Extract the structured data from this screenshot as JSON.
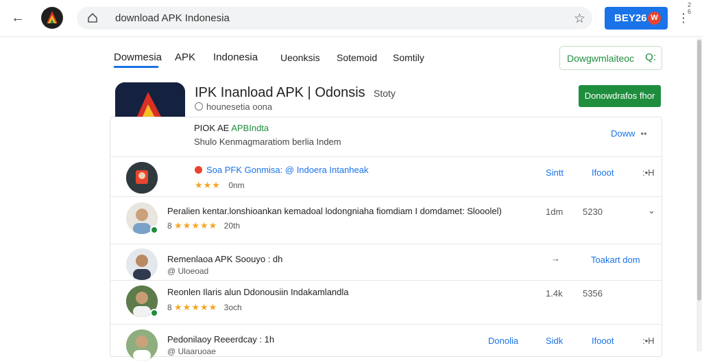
{
  "browser": {
    "address": "download APK Indonesia",
    "profile_label": "BEY26",
    "profile_badge": "W",
    "corner_digits": "2\n6"
  },
  "nav": {
    "tabs": [
      "Dowmesia",
      "APK",
      "Indonesia",
      "Ueonksis",
      "Sotemoid",
      "Somtily"
    ],
    "search_label": "Dowgwmlaiteoc",
    "search_icon_label": "Q:"
  },
  "app": {
    "title": "IPK Inanload APK | Odonsis",
    "side_label": "Stoty",
    "subtitle": "hounesetia oona",
    "install_label": "Donowdrafos fhor"
  },
  "card": {
    "head_prefix": "PIOK AE",
    "head_green": "APBIndta",
    "head_sub": "Shulo Kenmagmaratiom berlia Indem",
    "more_label": "Doww",
    "more_dots": "••"
  },
  "rows": [
    {
      "title": "Soa PFK Gonmisa: @ Indoera Intanheak",
      "rating": "2.5",
      "stars": "★★★",
      "meta": "0nm",
      "action1": "Sintt",
      "action2": "Ifooot",
      "action3": ":•H"
    },
    {
      "title": "Peralien kentar.lonshioankan kemadoal lodongniaha fiomdiam I domdamet: Slooolel)",
      "rating": "8",
      "stars": "★★★★★",
      "meta": "20th",
      "action1": "1dm",
      "action2": "5230",
      "action3": "⌄"
    },
    {
      "title": "Remenlaoa APK Soouyo : dh",
      "meta": "@ Uloeoad",
      "action1": "→",
      "action2": "Toakart dom"
    },
    {
      "title": "Reonlen Ilaris alun Ddonousiin  Indakamlandla",
      "rating": "8",
      "stars": "★★★★★",
      "meta": "3och",
      "action1": "1.4k",
      "action2": "5356"
    },
    {
      "title": "Pedonilaoy Reeerdcay : 1h",
      "meta": "@ Ulaaruoae",
      "action0": "Donolia",
      "action1": "Sidk",
      "action2": "Ifooot",
      "action3": ":•H"
    }
  ],
  "colors": {
    "accent_blue": "#1a73e8",
    "accent_green": "#1e8e3e",
    "star": "#f5a623",
    "badge_red": "#e8442e"
  }
}
